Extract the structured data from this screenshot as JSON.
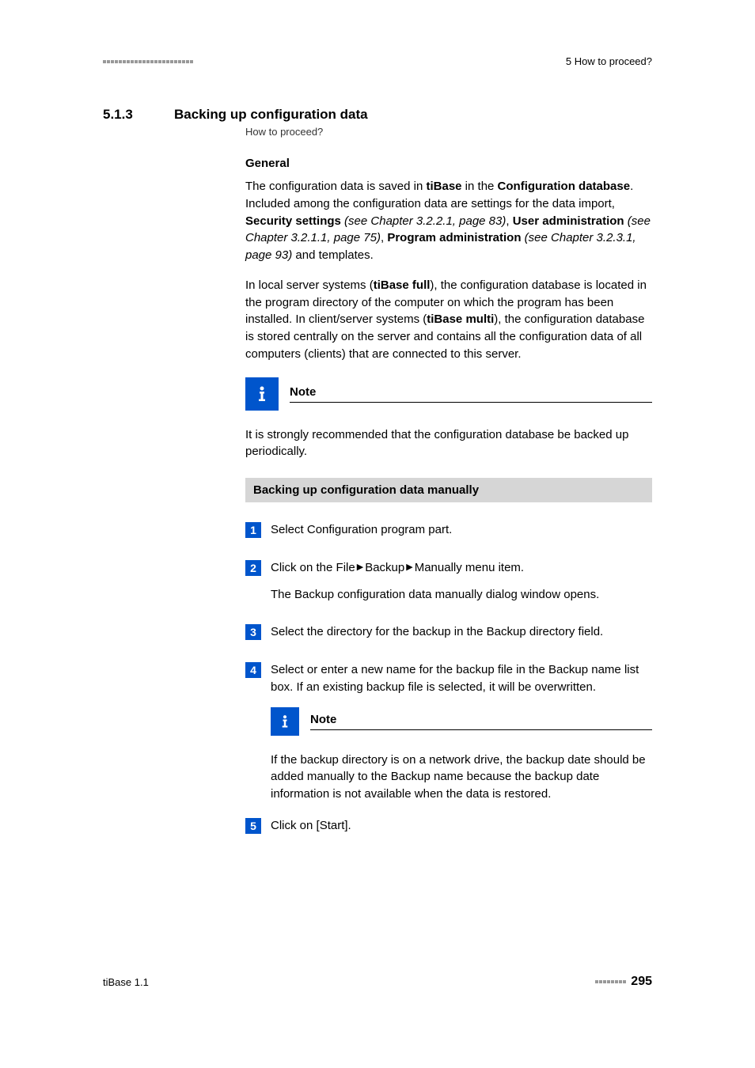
{
  "header": {
    "right": "5 How to proceed?"
  },
  "section": {
    "number": "5.1.3",
    "title": "Backing up configuration data",
    "breadcrumb": "How to proceed?"
  },
  "general": {
    "heading": "General",
    "p1_a": "The configuration data is saved in ",
    "p1_b": "tiBase",
    "p1_c": " in the ",
    "p1_d": "Configuration database",
    "p1_e": ". Included among the configuration data are settings for the data import, ",
    "p1_f": "Security settings",
    "p1_g": " (see Chapter 3.2.2.1, page 83)",
    "p1_h": ", ",
    "p1_i": "User administration",
    "p1_j": " (see Chapter 3.2.1.1, page 75)",
    "p1_k": ", ",
    "p1_l": "Program administration",
    "p1_m": " (see Chapter 3.2.3.1, page 93)",
    "p1_n": " and templates.",
    "p2_a": "In local server systems (",
    "p2_b": "tiBase full",
    "p2_c": "), the configuration database is located in the program directory of the computer on which the program has been installed. In client/server systems (",
    "p2_d": "tiBase multi",
    "p2_e": "), the configuration database is stored centrally on the server and contains all the configuration data of all computers (clients) that are connected to this server."
  },
  "note1": {
    "title": "Note",
    "body": "It is strongly recommended that the configuration database be backed up periodically."
  },
  "manual": {
    "heading": "Backing up configuration data manually"
  },
  "steps": {
    "s1_a": "Select ",
    "s1_b": "Configuration",
    "s1_c": " program part.",
    "s2_a": "Click on the ",
    "s2_b": "File",
    "s2_c": "Backup",
    "s2_d": "Manually",
    "s2_e": " menu item.",
    "s2_sub_a": "The ",
    "s2_sub_b": "Backup configuration data manually",
    "s2_sub_c": " dialog window opens.",
    "s3_a": "Select the directory for the backup in the ",
    "s3_b": "Backup directory",
    "s3_c": " field.",
    "s4_a": "Select or enter a new name for the backup file in the ",
    "s4_b": "Backup name",
    "s4_c": " list box. If an existing backup file is selected, it will be overwritten.",
    "s5_a": "Click on ",
    "s5_b": "[Start]",
    "s5_c": "."
  },
  "note2": {
    "title": "Note",
    "body_a": "If the backup directory is on a network drive, the backup date should be added manually to the ",
    "body_b": "Backup name",
    "body_c": " because the backup date information is not available when the data is restored."
  },
  "footer": {
    "left": "tiBase 1.1",
    "page": "295"
  }
}
